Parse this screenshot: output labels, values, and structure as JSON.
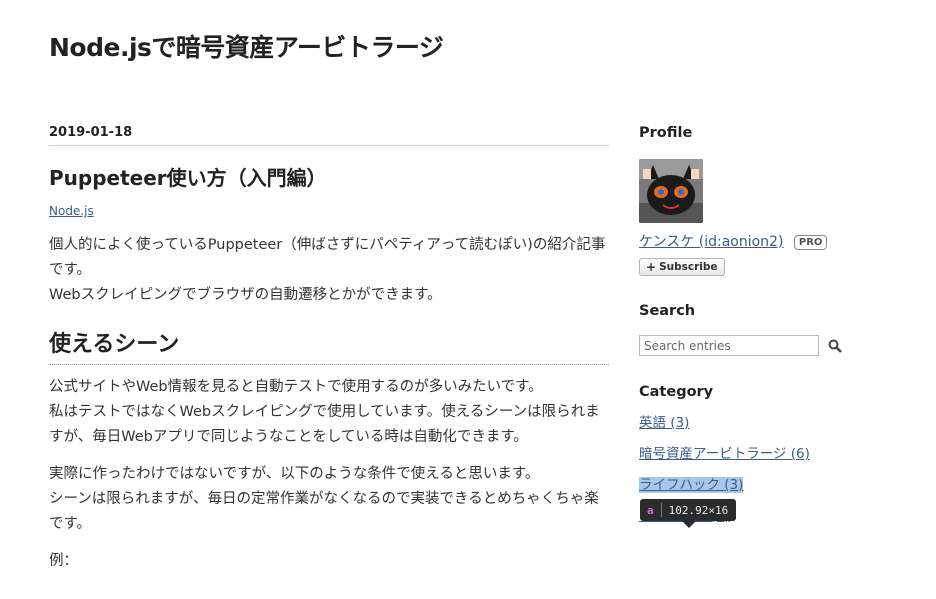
{
  "blog": {
    "title": "Node.jsで暗号資産アービトラージ"
  },
  "entry": {
    "date": "2019-01-18",
    "title": "Puppeteer使い方（入門編）",
    "category": "Node.js",
    "intro_line1": "個人的によく使っているPuppeteer（伸ばさずにパペティアって読むぽい)の紹介記事です。",
    "intro_line2": "Webスクレイピングでブラウザの自動遷移とかができます。",
    "section_heading": "使えるシーン",
    "section_p1_line1": "公式サイトやWeb情報を見ると自動テストで使用するのが多いみたいです。",
    "section_p1_line2": "私はテストではなくWebスクレイピングで使用しています。使えるシーンは限られますが、毎日Webアプリで同じようなことをしている時は自動化できます。",
    "section_p2_line1": "実際に作ったわけではないですが、以下のような条件で使えると思います。",
    "section_p2_line2": "シーンは限られますが、毎日の定常作業がなくなるので実装できるとめちゃくちゃ楽です。",
    "example_label": "例："
  },
  "sidebar": {
    "profile": {
      "title": "Profile",
      "name": "ケンスケ (id:aonion2)",
      "badge": "PRO",
      "subscribe_label": "Subscribe"
    },
    "search": {
      "title": "Search",
      "placeholder": "Search entries",
      "icon": "search-icon"
    },
    "category": {
      "title": "Category",
      "items": [
        {
          "label": "英語 (3)"
        },
        {
          "label": "暗号資産アービトラージ (6)"
        },
        {
          "label": "ライフハック (3)"
        },
        {
          "label": "おすすめ本 (2)"
        }
      ]
    }
  },
  "devtools_tooltip": {
    "tag": "a",
    "size": "102.92×16"
  },
  "colors": {
    "link": "#3a5c8a",
    "highlight": "#a8c7ea",
    "tooltip_bg": "#2b2b2b",
    "tag_color": "#d56be0"
  }
}
